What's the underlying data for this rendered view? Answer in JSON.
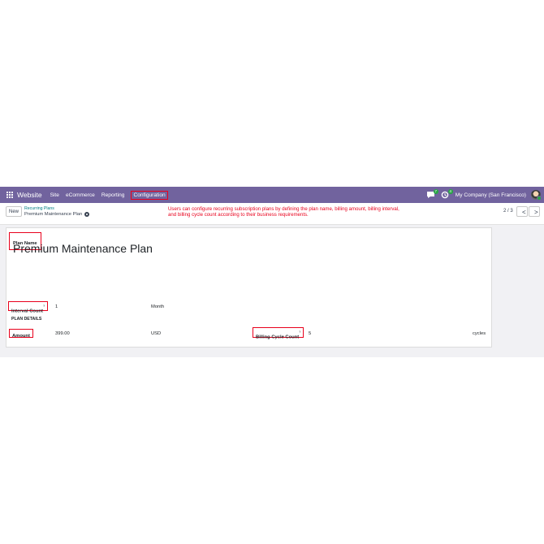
{
  "navbar": {
    "app_name": "Website",
    "menu": [
      "Site",
      "eCommerce",
      "Reporting",
      "Configuration"
    ],
    "messages_count": "7",
    "activities_count": "4",
    "company": "My Company (San Francisco)",
    "color": "#71639e"
  },
  "control": {
    "new_label": "New",
    "breadcrumb_parent": "Recurring Plans",
    "breadcrumb_current": "Premium Maintenance Plan",
    "pager": "2 / 3",
    "prev_label": "<",
    "next_label": ">"
  },
  "annotation": {
    "line1": "Users can configure recurring subscription plans by defining the plan name, billing amount, billing interval,",
    "line2": "and billing cycle count according to their business requirements."
  },
  "form": {
    "plan_name_label": "Plan Name",
    "plan_name_value": "Premium Maintenance Plan",
    "section_title": "PLAN DETAILS",
    "amount_label": "Amount",
    "amount_value": "399.00",
    "currency": "USD",
    "interval_label": "Interval Count",
    "interval_help": "?",
    "interval_value": "1",
    "interval_unit": "Month",
    "billing_cycle_label": "Billing Cycle Count",
    "billing_cycle_help": "?",
    "billing_cycle_value": "5",
    "billing_cycle_unit": "cycles"
  },
  "colors": {
    "highlight": "#e8001c",
    "link": "#017e84"
  }
}
